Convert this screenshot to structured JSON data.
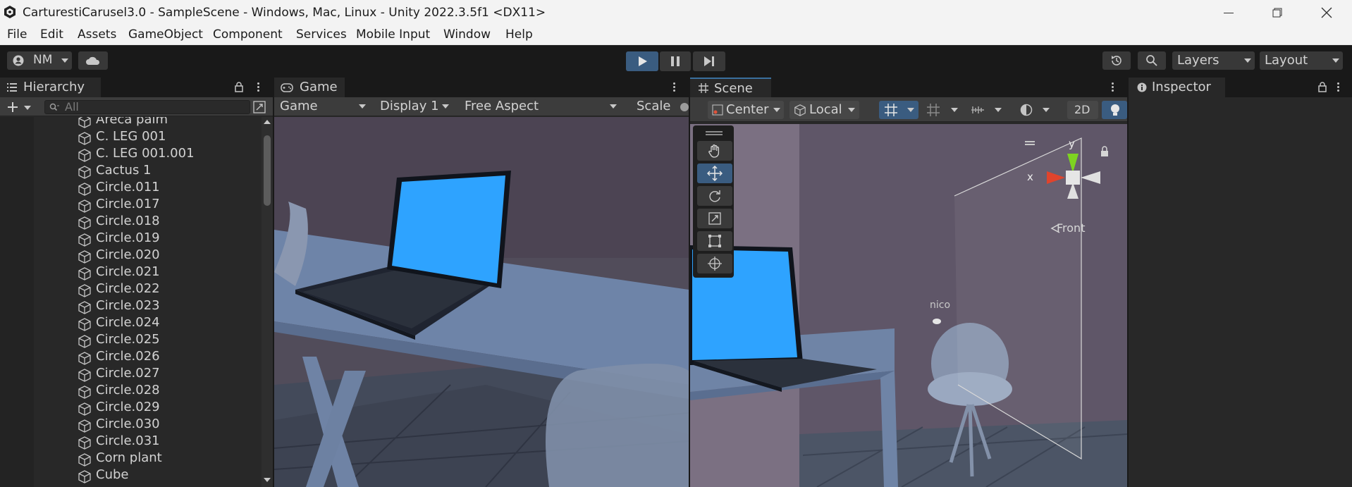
{
  "window": {
    "title": "CarturestiCarusel3.0 - SampleScene - Windows, Mac, Linux - Unity 2022.3.5f1 <DX11>"
  },
  "menu": [
    "File",
    "Edit",
    "Assets",
    "GameObject",
    "Component",
    "Services",
    "Mobile Input",
    "Window",
    "Help"
  ],
  "toolbar": {
    "account_label": "NM",
    "layers_label": "Layers",
    "layout_label": "Layout"
  },
  "hierarchy": {
    "tab_label": "Hierarchy",
    "search_placeholder": "All",
    "items": [
      "Areca palm",
      "C. LEG 001",
      "C. LEG 001.001",
      "Cactus 1",
      "Circle.011",
      "Circle.017",
      "Circle.018",
      "Circle.019",
      "Circle.020",
      "Circle.021",
      "Circle.022",
      "Circle.023",
      "Circle.024",
      "Circle.025",
      "Circle.026",
      "Circle.027",
      "Circle.028",
      "Circle.029",
      "Circle.030",
      "Circle.031",
      "Corn plant",
      "Cube"
    ]
  },
  "game": {
    "tab_label": "Game",
    "mode": "Game",
    "display": "Display 1",
    "aspect": "Free Aspect",
    "scale_label": "Scale"
  },
  "scene": {
    "tab_label": "Scene",
    "pivot": "Center",
    "space": "Local",
    "mode_2d": "2D",
    "gizmo": {
      "x": "x",
      "y": "y",
      "view": "Front"
    },
    "object_label": "nico"
  },
  "inspector": {
    "tab_label": "Inspector"
  },
  "colors": {
    "accent": "#3a6f9e",
    "laptop_screen": "#2ea3ff",
    "panel_bg": "#282828"
  }
}
